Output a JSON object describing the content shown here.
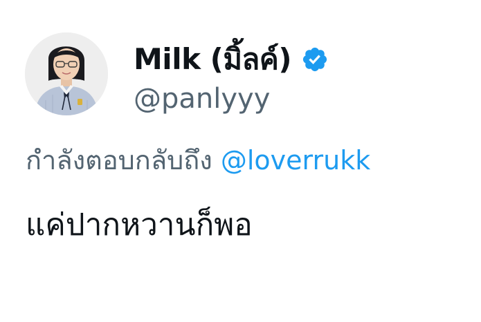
{
  "author": {
    "display_name": "Milk (มิ้ลค์)",
    "handle": "@panlyyy",
    "verified": true,
    "verified_icon": "verified-badge-icon",
    "avatar_icon": "profile-avatar"
  },
  "reply": {
    "prefix": "กำลังตอบกลับถึง ",
    "mention": "@loverrukk"
  },
  "tweet": {
    "text": "แค่ปากหวานก็พอ"
  },
  "colors": {
    "text": "#0f1419",
    "secondary": "#536471",
    "accent": "#1d9bf0"
  }
}
